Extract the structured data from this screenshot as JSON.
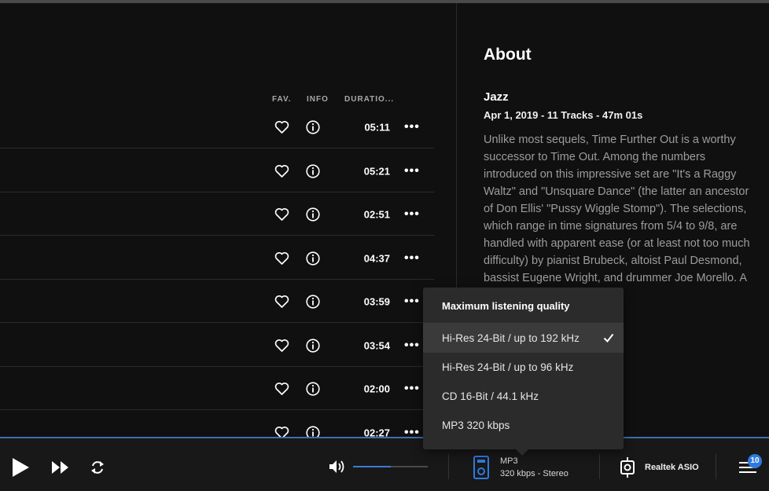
{
  "tracklist": {
    "columns": {
      "fav": "FAV.",
      "info": "INFO",
      "duration": "DURATIO..."
    },
    "rows": [
      {
        "duration": "05:11"
      },
      {
        "duration": "05:21"
      },
      {
        "duration": "02:51"
      },
      {
        "duration": "04:37"
      },
      {
        "duration": "03:59"
      },
      {
        "duration": "03:54"
      },
      {
        "duration": "02:00"
      },
      {
        "duration": "02:27"
      }
    ],
    "more_glyph": "•••"
  },
  "about": {
    "title": "About",
    "genre": "Jazz",
    "meta": "Apr 1, 2019 - 11 Tracks - 47m 01s",
    "description": "Unlike most sequels, Time Further Out is a worthy successor to Time Out. Among the numbers introduced on this impressive set are \"It's a Raggy Waltz\" and \"Unsquare Dance\" (the latter an ancestor of Don Ellis' \"Pussy Wiggle Stomp\"). The selections, which range in time signatures from 5/4 to 9/8, are handled with apparent ease (or at least not too much difficulty) by pianist Brubeck, altoist Paul Desmond, bassist Eugene Wright, and drummer Joe Morello. A near-classic."
  },
  "quality_menu": {
    "title": "Maximum listening quality",
    "options": [
      {
        "label": "Hi-Res 24-Bit / up to 192 kHz",
        "selected": true
      },
      {
        "label": "Hi-Res 24-Bit / up to 96 kHz",
        "selected": false
      },
      {
        "label": "CD 16-Bit / 44.1 kHz",
        "selected": false
      },
      {
        "label": "MP3 320 kbps",
        "selected": false
      }
    ]
  },
  "player": {
    "volume": 0.5,
    "quality_format": "MP3",
    "quality_detail": "320 kbps - Stereo",
    "output_device": "Realtek ASIO",
    "queue_count": "10"
  },
  "colors": {
    "accent": "#3d7ad6",
    "background": "#101010",
    "player_bg": "#181818",
    "menu_bg": "#2b2b2b"
  }
}
